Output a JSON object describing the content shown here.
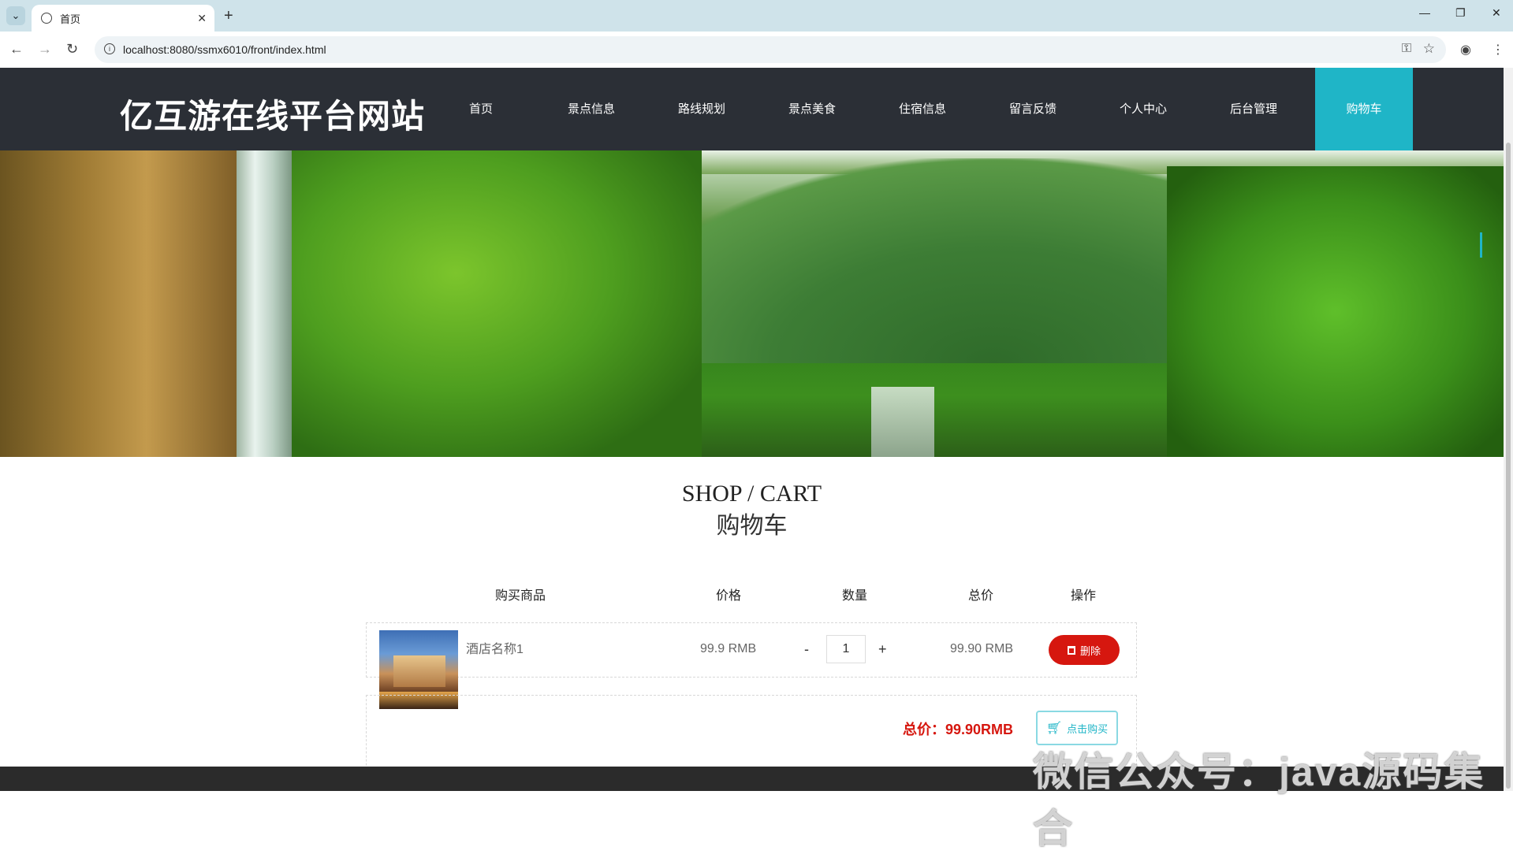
{
  "browser": {
    "tab_title": "首页",
    "url": "localhost:8080/ssmx6010/front/index.html"
  },
  "site": {
    "logo": "亿互游在线平台网站",
    "nav": [
      {
        "label": "首页"
      },
      {
        "label": "景点信息"
      },
      {
        "label": "路线规划"
      },
      {
        "label": "景点美食"
      },
      {
        "label": "住宿信息"
      },
      {
        "label": "留言反馈"
      },
      {
        "label": "个人中心"
      },
      {
        "label": "后台管理"
      },
      {
        "label": "购物车",
        "active": true
      }
    ]
  },
  "cart": {
    "title_en": "SHOP / CART",
    "title_cn": "购物车",
    "headers": {
      "product": "购买商品",
      "price": "价格",
      "quantity": "数量",
      "total": "总价",
      "action": "操作"
    },
    "items": [
      {
        "name": "酒店名称1",
        "price": "99.9 RMB",
        "quantity": "1",
        "subtotal": "99.90 RMB",
        "delete_label": "删除"
      }
    ],
    "qty_minus": "-",
    "qty_plus": "+",
    "grand_total": "总价：99.90RMB",
    "buy_label": "点击购买"
  },
  "watermark": "微信公众号：java源码集合",
  "colors": {
    "header_bg": "#2b2f36",
    "accent": "#1fb5c7",
    "danger": "#d6170f"
  }
}
